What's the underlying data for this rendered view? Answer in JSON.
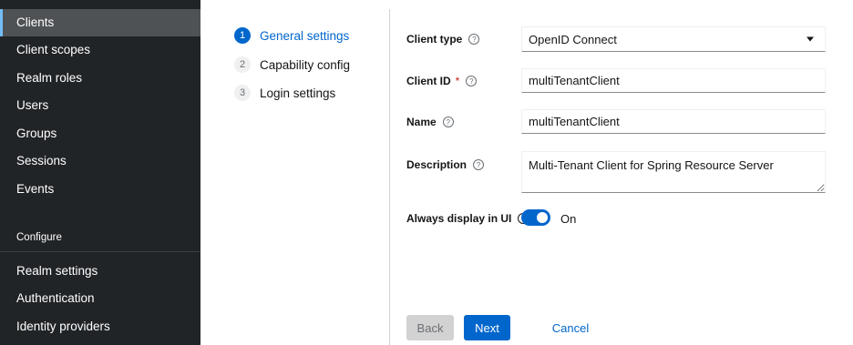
{
  "sidebar": {
    "items": [
      {
        "label": "Clients"
      },
      {
        "label": "Client scopes"
      },
      {
        "label": "Realm roles"
      },
      {
        "label": "Users"
      },
      {
        "label": "Groups"
      },
      {
        "label": "Sessions"
      },
      {
        "label": "Events"
      }
    ],
    "configure_section": "Configure",
    "configure_items": [
      {
        "label": "Realm settings"
      },
      {
        "label": "Authentication"
      },
      {
        "label": "Identity providers"
      }
    ]
  },
  "wizard": {
    "steps": [
      {
        "num": "1",
        "label": "General settings"
      },
      {
        "num": "2",
        "label": "Capability config"
      },
      {
        "num": "3",
        "label": "Login settings"
      }
    ]
  },
  "form": {
    "client_type_label": "Client type",
    "client_type_value": "OpenID Connect",
    "client_id_label": "Client ID",
    "required_mark": "*",
    "client_id_value": "multiTenantClient",
    "name_label": "Name",
    "name_value": "multiTenantClient",
    "description_label": "Description",
    "description_value": "Multi-Tenant Client for Spring Resource Server",
    "always_display_label": "Always display in UI",
    "always_display_state": "On",
    "help_glyph": "?"
  },
  "buttons": {
    "back": "Back",
    "next": "Next",
    "cancel": "Cancel"
  },
  "colors": {
    "accent": "#0066cc",
    "sidebar_bg": "#212427",
    "active_item_bg": "#4f5255"
  }
}
